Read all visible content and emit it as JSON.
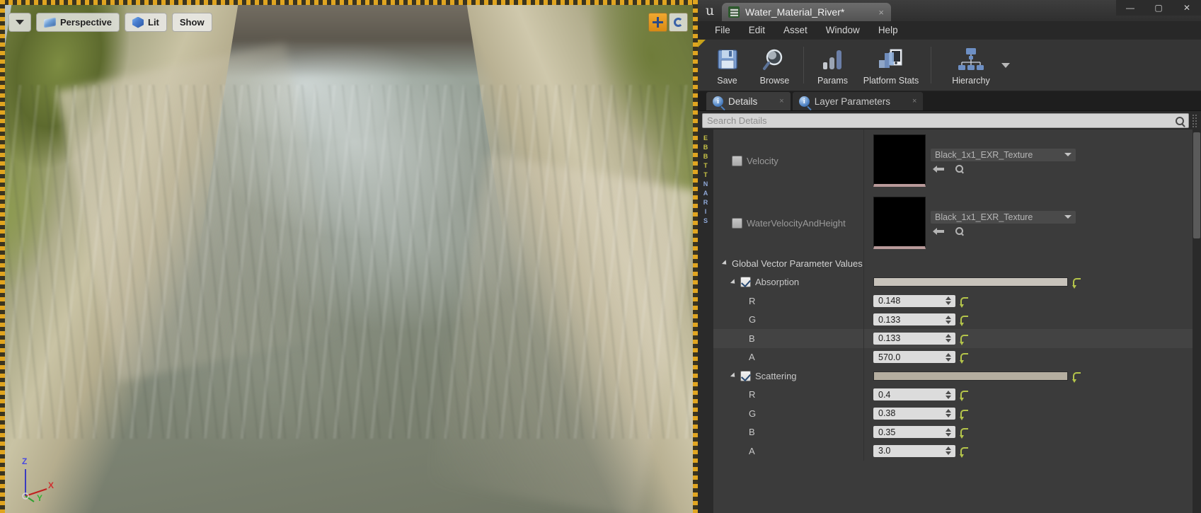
{
  "viewport": {
    "dropdown_label": "▾",
    "perspective_label": "Perspective",
    "lit_label": "Lit",
    "show_label": "Show",
    "gizmo": {
      "z": "Z",
      "y": "Y",
      "x": "X"
    }
  },
  "window": {
    "logo": "u",
    "document_tab": "Water_Material_River*",
    "tab_close": "×",
    "minimize": "—",
    "maximize": "▢",
    "close": "✕"
  },
  "menubar": {
    "items": [
      "File",
      "Edit",
      "Asset",
      "Window",
      "Help"
    ]
  },
  "toolbar": {
    "buttons": [
      {
        "label": "Save",
        "icon": "floppy-disk-icon"
      },
      {
        "label": "Browse",
        "icon": "magnifier-icon"
      },
      {
        "label": "Params",
        "icon": "bar-chart-icon"
      },
      {
        "label": "Platform Stats",
        "icon": "monitor-stats-icon"
      },
      {
        "label": "Hierarchy",
        "icon": "node-tree-icon"
      }
    ]
  },
  "panel_tabs": [
    {
      "label": "Details",
      "active": true
    },
    {
      "label": "Layer Parameters",
      "active": false
    }
  ],
  "search": {
    "value": "",
    "placeholder": "Search Details"
  },
  "side_strip": {
    "letters": [
      "E",
      "B",
      "B",
      "T",
      "T",
      "N",
      "A",
      "R",
      "I",
      "S"
    ]
  },
  "properties": {
    "texture_rows": [
      {
        "name": "Velocity",
        "checked": false,
        "texture": "Black_1x1_EXR_Texture",
        "thumb_color": "#000000"
      },
      {
        "name": "WaterVelocityAndHeight",
        "checked": false,
        "texture": "Black_1x1_EXR_Texture",
        "thumb_color": "#000000"
      }
    ],
    "section": {
      "title": "Global Vector Parameter Values",
      "groups": [
        {
          "name": "Absorption",
          "checked": true,
          "swatch_color": "#c8c3bb",
          "channels": [
            {
              "label": "R",
              "value": "0.148"
            },
            {
              "label": "G",
              "value": "0.133"
            },
            {
              "label": "B",
              "value": "0.133"
            },
            {
              "label": "A",
              "value": "570.0"
            }
          ]
        },
        {
          "name": "Scattering",
          "checked": true,
          "swatch_color": "#b5aea0",
          "channels": [
            {
              "label": "R",
              "value": "0.4"
            },
            {
              "label": "G",
              "value": "0.38"
            },
            {
              "label": "B",
              "value": "0.35"
            },
            {
              "label": "A",
              "value": "3.0"
            }
          ]
        }
      ]
    }
  },
  "colors": {
    "accent_orange": "#e0a520",
    "panel_bg": "#3b3b3b",
    "toolbar_bg": "#353535",
    "checkbox_check": "#28486f",
    "reset_green": "#b4c44a"
  }
}
